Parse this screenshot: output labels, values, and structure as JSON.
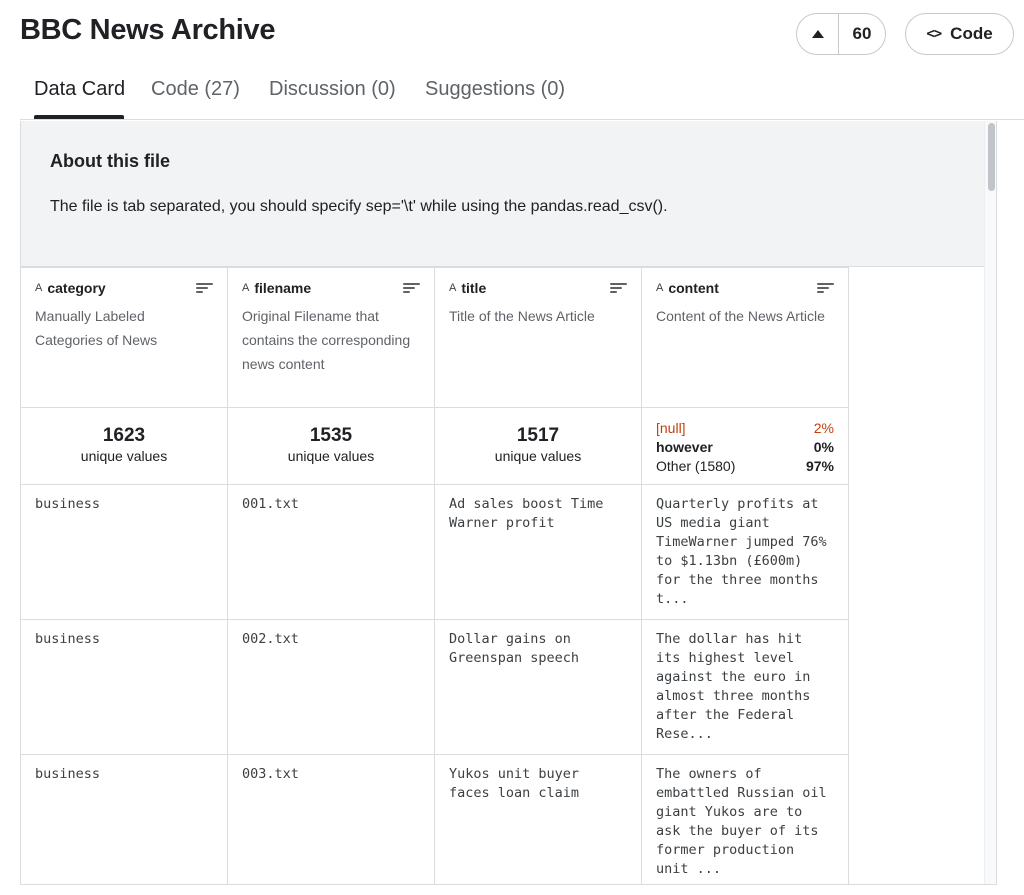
{
  "header": {
    "title": "BBC News Archive",
    "vote_count": "60",
    "code_label": "Code",
    "code_icon": "<>"
  },
  "tabs": [
    {
      "label": "Data Card",
      "active": true
    },
    {
      "label": "Code (27)",
      "active": false
    },
    {
      "label": "Discussion (0)",
      "active": false
    },
    {
      "label": "Suggestions (0)",
      "active": false
    }
  ],
  "about": {
    "title": "About this file",
    "text": "The file is tab separated, you should specify sep='\\t' while using the pandas.read_csv()."
  },
  "columns": [
    {
      "type_icon": "A",
      "name": "category",
      "description": "Manually Labeled Categories of News",
      "unique_count": "1623",
      "unique_label": "unique values"
    },
    {
      "type_icon": "A",
      "name": "filename",
      "description": "Original Filename that contains the corresponding news content",
      "unique_count": "1535",
      "unique_label": "unique values"
    },
    {
      "type_icon": "A",
      "name": "title",
      "description": "Title of the News Article",
      "unique_count": "1517",
      "unique_label": "unique values"
    },
    {
      "type_icon": "A",
      "name": "content",
      "description": "Content of the News Article"
    }
  ],
  "content_distribution": [
    {
      "label": "[null]",
      "value": "2%"
    },
    {
      "label": "however",
      "value": "0%"
    },
    {
      "label": "Other (1580)",
      "value": "97%"
    }
  ],
  "rows": [
    [
      "business",
      "001.txt",
      "Ad sales boost Time Warner profit",
      "Quarterly profits at US media giant TimeWarner jumped 76% to $1.13bn (£600m) for the three months t..."
    ],
    [
      "business",
      "002.txt",
      "Dollar gains on Greenspan speech",
      "The dollar has hit its highest level against the euro in almost three months after the Federal Rese..."
    ],
    [
      "business",
      "003.txt",
      "Yukos unit buyer faces loan claim",
      "The owners of embattled Russian oil giant Yukos are to ask the buyer of its former production unit ..."
    ]
  ],
  "colors": {
    "accent": "#202124",
    "null_label": "#c2410c",
    "about_bg": "#f1f3f4"
  }
}
